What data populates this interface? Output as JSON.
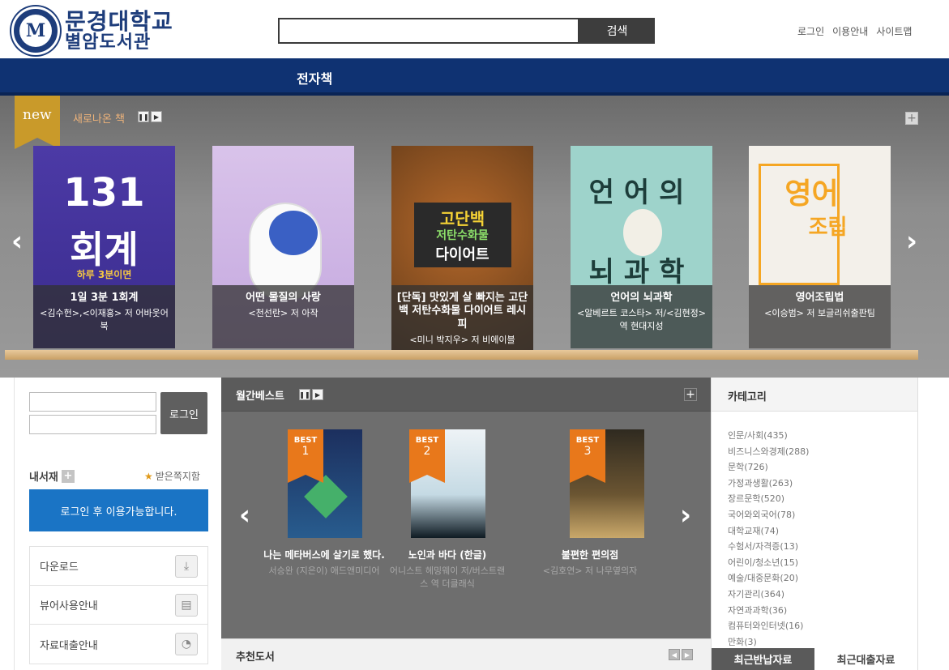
{
  "header": {
    "logo_line1": "문경대학교",
    "logo_line2": "별암도서관",
    "search_placeholder": "",
    "search_button": "검색",
    "links": [
      "로그인",
      "이용안내",
      "사이트맵"
    ]
  },
  "nav": {
    "items": [
      "전자책"
    ]
  },
  "new_books": {
    "badge": "new",
    "title": "새로나온 책",
    "books": [
      {
        "title": "1일 3분 1회계",
        "authors": "<김수헌>,<이재홍> 저",
        "publisher": "어바웃어북"
      },
      {
        "title": "어떤 물질의 사랑",
        "authors": "<천선란> 저",
        "publisher": "아작"
      },
      {
        "title": "[단독] 맛있게 살 빠지는 고단백 저탄수화물 다이어트 레시피",
        "authors": "<미니 박지우> 저",
        "publisher": "비에이블"
      },
      {
        "title": "언어의 뇌과학",
        "authors": "<알베르트 코스타> 저/<김현정> 역",
        "publisher": "현대지성"
      },
      {
        "title": "영어조립법",
        "authors": "<이승범> 저",
        "publisher": "보글리쉬출판팀"
      }
    ]
  },
  "login": {
    "button": "로그인"
  },
  "my_shelf": {
    "label": "내서재",
    "notice": "받은쪽지함",
    "login_required": "로그인 후 이용가능합니다.",
    "menu": [
      {
        "label": "다운로드",
        "icon": "download-icon"
      },
      {
        "label": "뷰어사용안내",
        "icon": "viewer-icon"
      },
      {
        "label": "자료대출안내",
        "icon": "info-icon"
      }
    ]
  },
  "monthly_best": {
    "title": "월간베스트",
    "books": [
      {
        "rank": "1",
        "badge": "BEST",
        "title": "나는 메타버스에 살기로 했다.",
        "authors": "서승완 (지은이)",
        "publisher": "애드앤미디어"
      },
      {
        "rank": "2",
        "badge": "BEST",
        "title": "노인과 바다 (한글)",
        "authors": "어니스트 헤밍웨이 저/버스트랜스 역",
        "publisher": "더클래식"
      },
      {
        "rank": "3",
        "badge": "BEST",
        "title": "불편한 편의점",
        "authors": "<김호연> 저",
        "publisher": "나무옆의자"
      }
    ]
  },
  "recommended": {
    "title": "추천도서"
  },
  "categories": {
    "title": "카테고리",
    "items": [
      "인문/사회(435)",
      "비즈니스와경제(288)",
      "문학(726)",
      "가정과생활(263)",
      "장르문학(520)",
      "국어와외국어(78)",
      "대학교재(74)",
      "수험서/자격증(13)",
      "어린이/청소년(15)",
      "예술/대중문화(20)",
      "자기관리(364)",
      "자연과과학(36)",
      "컴퓨터와인터넷(16)",
      "만화(3)"
    ]
  },
  "bottom_tabs": {
    "active": "최근반납자료",
    "inactive": "최근대출자료"
  },
  "colors": {
    "nav": "#0f3272",
    "accent_blue": "#1a74c5",
    "best_ribbon": "#e8781b",
    "new_badge": "#c99a2a"
  }
}
